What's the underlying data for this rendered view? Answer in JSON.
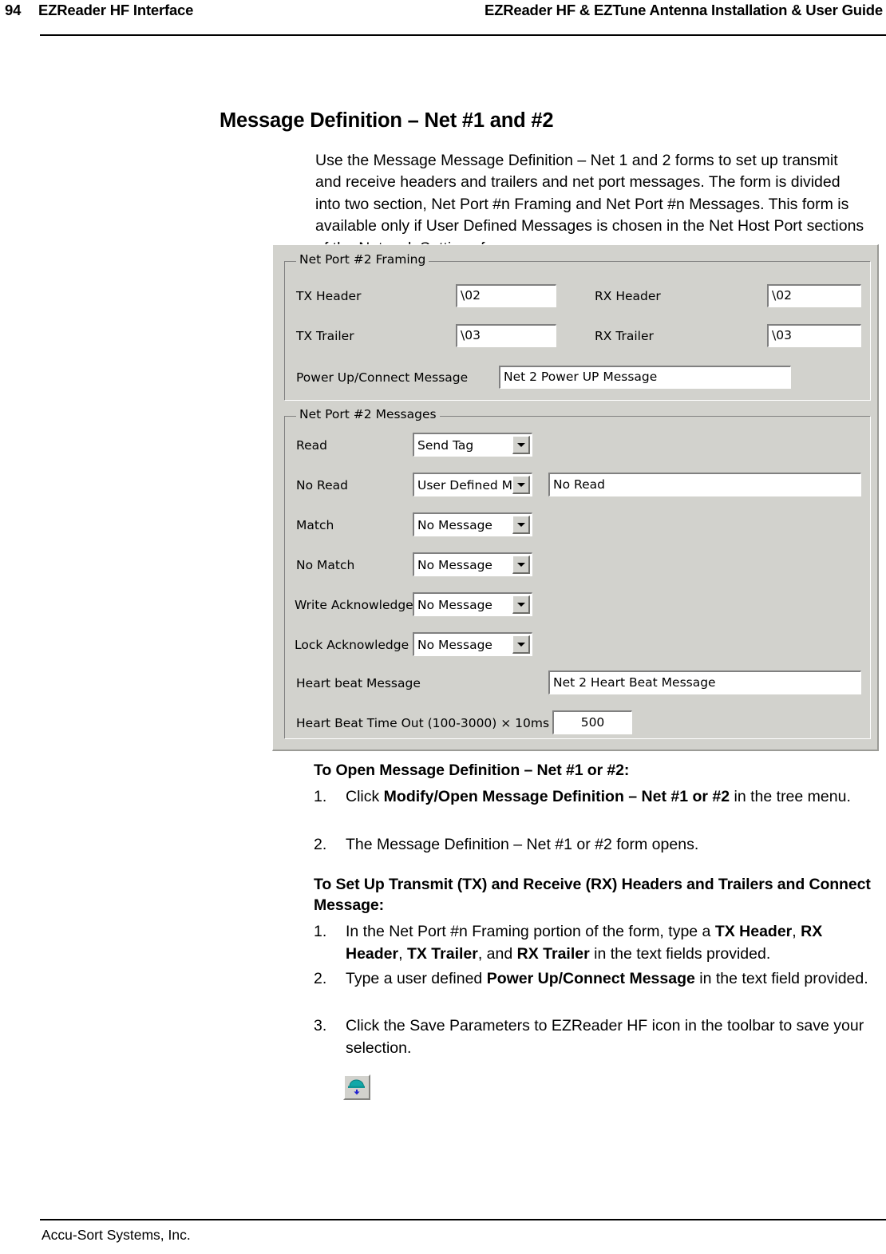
{
  "header": {
    "page_number": "94",
    "left_title": "EZReader HF Interface",
    "right_title": "EZReader HF & EZTune Antenna Installation & User Guide"
  },
  "footer": {
    "company": "Accu-Sort Systems, Inc."
  },
  "section": {
    "title": "Message Definition – Net #1 and #2",
    "intro": "Use the Message Message Definition – Net 1 and 2 forms to set up transmit and receive headers and trailers and net port messages. The form is divided into two section, Net Port #n Framing and Net Port #n Messages. This form is available only if User Defined Messages is chosen in the Net Host Port sections of the Network Settings form."
  },
  "dialog": {
    "framing": {
      "legend": "Net Port #2 Framing",
      "tx_header_label": "TX Header",
      "tx_header_value": "\\02",
      "rx_header_label": "RX Header",
      "rx_header_value": "\\02",
      "tx_trailer_label": "TX Trailer",
      "tx_trailer_value": "\\03",
      "rx_trailer_label": "RX Trailer",
      "rx_trailer_value": "\\03",
      "power_up_label": "Power Up/Connect Message",
      "power_up_value": "Net 2 Power UP Message"
    },
    "messages": {
      "legend": "Net Port #2 Messages",
      "read_label": "Read",
      "read_value": "Send Tag",
      "no_read_label": "No Read",
      "no_read_value": "User Defined M",
      "no_read_text": "No Read",
      "match_label": "Match",
      "match_value": "No Message",
      "no_match_label": "No Match",
      "no_match_value": "No Message",
      "write_ack_label": "Write Acknowledge",
      "write_ack_value": "No Message",
      "lock_ack_label": "Lock Acknowledge",
      "lock_ack_value": "No Message",
      "heart_beat_label": "Heart beat Message",
      "heart_beat_value": "Net 2 Heart Beat Message",
      "heart_beat_timeout_label": "Heart Beat Time Out (100-3000) × 10ms",
      "heart_beat_timeout_value": "500"
    }
  },
  "procedures": [
    {
      "heading": "To Open Message Definition – Net #1 or #2:",
      "steps": [
        {
          "num": "1.",
          "html": "Click <b>Modify/Open Message Definition – Net #1 or #2</b> in the tree menu."
        },
        {
          "num": "2.",
          "html": "The Message Definition – Net #1 or #2 form opens."
        }
      ]
    },
    {
      "heading": "To Set Up Transmit (TX) and Receive (RX) Headers and Trailers and Connect Message:",
      "steps": [
        {
          "num": "1.",
          "html": "In the Net Port #n Framing portion of the form, type a <b>TX Header</b>, <b>RX Header</b>, <b>TX Trailer</b>, and <b>RX Trailer</b> in the text fields provided."
        },
        {
          "num": "2.",
          "html": "Type a user defined <b>Power Up/Connect Message</b> in the text field provided."
        },
        {
          "num": "3.",
          "html": "Click the Save Parameters to EZReader HF icon in the toolbar to save your selection."
        }
      ]
    }
  ],
  "icons": {
    "save_parameters": "save-parameters-icon"
  },
  "colors": {
    "dialog_face": "#d2d2cd",
    "field_background": "#ffffff",
    "icon_teal": "#11a8a8",
    "icon_blue": "#2020d0"
  }
}
